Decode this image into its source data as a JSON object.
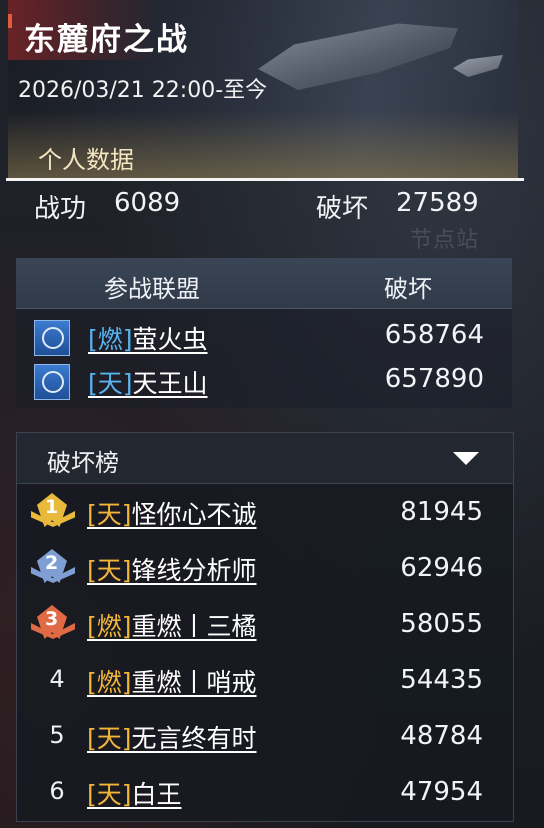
{
  "header": {
    "title": "东麓府之战",
    "datetime": "2026/03/21  22:00-至今",
    "section_label": "个人数据"
  },
  "personal": {
    "merit_label": "战功",
    "merit_value": "6089",
    "destroy_label": "破坏",
    "destroy_value": "27589"
  },
  "background": {
    "node_label": "节点站"
  },
  "alliance": {
    "col_name": "参战联盟",
    "col_destroy": "破坏",
    "rows": [
      {
        "tag": "[燃]",
        "name": "萤火虫",
        "value": "658764"
      },
      {
        "tag": "[天]",
        "name": "天王山",
        "value": "657890"
      }
    ]
  },
  "ranking": {
    "title": "破坏榜",
    "medal_colors": [
      "#e8b93a",
      "#7f9fd4",
      "#e06a44"
    ],
    "rows": [
      {
        "rank": "1",
        "tag": "[天]",
        "name": "怪你心不诚",
        "value": "81945"
      },
      {
        "rank": "2",
        "tag": "[天]",
        "name": "锋线分析师",
        "value": "62946"
      },
      {
        "rank": "3",
        "tag": "[燃]",
        "name": "重燃丨三橘",
        "value": "58055"
      },
      {
        "rank": "4",
        "tag": "[燃]",
        "name": "重燃丨哨戒",
        "value": "54435"
      },
      {
        "rank": "5",
        "tag": "[天]",
        "name": "无言终有时",
        "value": "48784"
      },
      {
        "rank": "6",
        "tag": "[天]",
        "name": "白王",
        "value": "47954"
      }
    ]
  }
}
